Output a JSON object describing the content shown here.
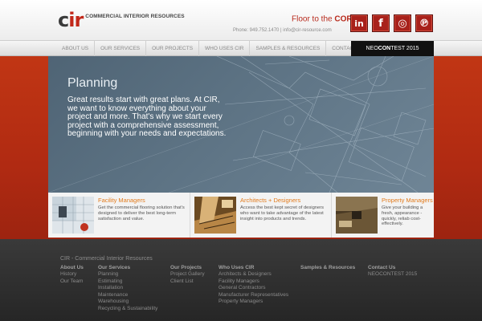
{
  "header": {
    "logo_mark_c": "c",
    "logo_mark_ir": "ir",
    "logo_text": "Commercial Interior Resources",
    "tagline_pre": "Floor to the ",
    "tagline_core": "CORE",
    "tagline_tm": "™",
    "contact": "Phone: 949.752.1470 | info@cir-resource.com",
    "social": [
      {
        "label": "in",
        "icon": "linkedin-icon"
      },
      {
        "label": "f",
        "icon": "facebook-icon"
      },
      {
        "label": "◎",
        "icon": "instagram-icon"
      },
      {
        "label": "℗",
        "icon": "pinterest-icon"
      }
    ]
  },
  "nav": {
    "items": [
      "About Us",
      "Our Services",
      "Our Projects",
      "Who Uses CIR",
      "Samples & Resources",
      "Contact Us"
    ],
    "neo_prefix": "NEO",
    "neo_bold": "CON",
    "neo_suffix": "TEST 2015"
  },
  "hero": {
    "title": "Planning",
    "text": "Great results start with great plans. At CIR, we want to know everything about your project and more. That's why we start every project with a comprehensive assessment, beginning with your needs and expectations."
  },
  "features": [
    {
      "title": "Facility Managers",
      "text": "Get the commercial flooring solution that's designed to deliver the best long-term satisfaction and value."
    },
    {
      "title": "Architects + Designers",
      "text": "Access the best kept secret of designers who want to take advantage of the latest insight into products and trends."
    },
    {
      "title": "Property Managers",
      "text": "Give your building a fresh, appearance - quickly, reliab cost-effectively."
    }
  ],
  "footer": {
    "brand": "CIR - Commercial Interior Resources",
    "columns": [
      {
        "heading": "About Us",
        "items": [
          "History",
          "Our Team"
        ]
      },
      {
        "heading": "Our Services",
        "items": [
          "Planning",
          "Estimating",
          "Installation",
          "Maintenance",
          "Warehousing",
          "Recycling & Sustainability"
        ]
      },
      {
        "heading": "Our Projects",
        "items": [
          "Project Gallery",
          "Client List"
        ]
      },
      {
        "heading": "Who Uses CIR",
        "items": [
          "Architects & Designers",
          "Facility Managers",
          "General Contractors",
          "Manufacturer Representatives",
          "Property Managers"
        ]
      },
      {
        "heading": "Samples & Resources",
        "items": []
      },
      {
        "heading": "Contact Us",
        "items": [
          "NEOCONTEST 2015"
        ]
      }
    ]
  },
  "colors": {
    "brand_red": "#b82a1c",
    "accent_orange": "#e27b1c",
    "hero_blue": "#5d7384"
  }
}
